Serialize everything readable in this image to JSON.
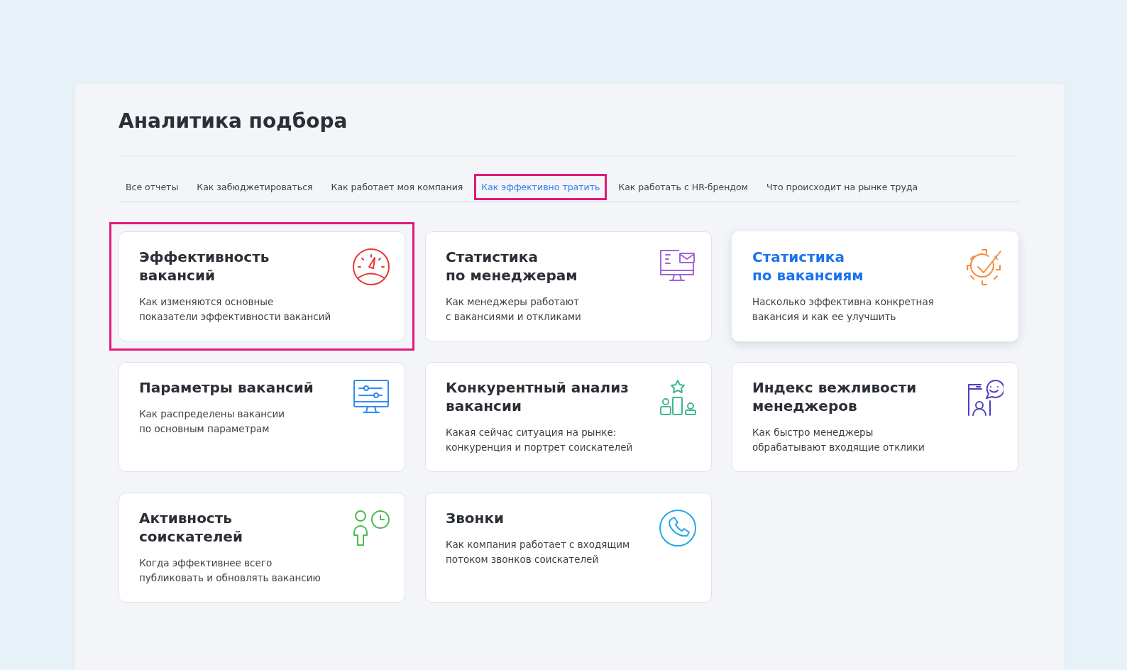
{
  "page": {
    "title": "Аналитика подбора"
  },
  "tabs": [
    {
      "label": "Все отчеты",
      "selected": false
    },
    {
      "label": "Как забюджетироваться",
      "selected": false
    },
    {
      "label": "Как работает моя компания",
      "selected": false
    },
    {
      "label": "Как эффективно тратить",
      "selected": true
    },
    {
      "label": "Как работать с HR-брендом",
      "selected": false
    },
    {
      "label": "Что происходит на рынке труда",
      "selected": false
    }
  ],
  "cards": [
    {
      "title": "Эффективность\nвакансий",
      "description": "Как изменяются основные\nпоказатели эффективности вакансий",
      "kind": "gauge",
      "highlighted": true,
      "hovered": false
    },
    {
      "title": "Статистика\nпо менеджерам",
      "description": "Как менеджеры работают\nс вакансиями и откликами",
      "kind": "monitor-mail",
      "highlighted": false,
      "hovered": false
    },
    {
      "title": "Статистика\nпо вакансиям",
      "description": "Насколько эффективна конкретная\nвакансия и как ее улучшить",
      "kind": "gear-check",
      "highlighted": false,
      "hovered": true
    },
    {
      "title": "Параметры вакансий",
      "description": "Как распределены вакансии\nпо основным параметрам",
      "kind": "monitor-sliders",
      "highlighted": false,
      "hovered": false
    },
    {
      "title": "Конкурентный анализ\nвакансии",
      "description": "Какая сейчас ситуация на рынке:\nконкуренция и портрет соискателей",
      "kind": "podium",
      "highlighted": false,
      "hovered": false
    },
    {
      "title": "Индекс вежливости\nменеджеров",
      "description": "Как быстро менеджеры\nобрабатывают входящие отклики",
      "kind": "phone-chat",
      "highlighted": false,
      "hovered": false
    },
    {
      "title": "Активность\nсоискателей",
      "description": "Когда эффективнее всего\nпубликовать и обновлять вакансию",
      "kind": "person-clock",
      "highlighted": false,
      "hovered": false
    },
    {
      "title": "Звонки",
      "description": "Как компания работает с входящим\nпотоком звонков соискателей",
      "kind": "phone",
      "highlighted": false,
      "hovered": false
    }
  ]
}
